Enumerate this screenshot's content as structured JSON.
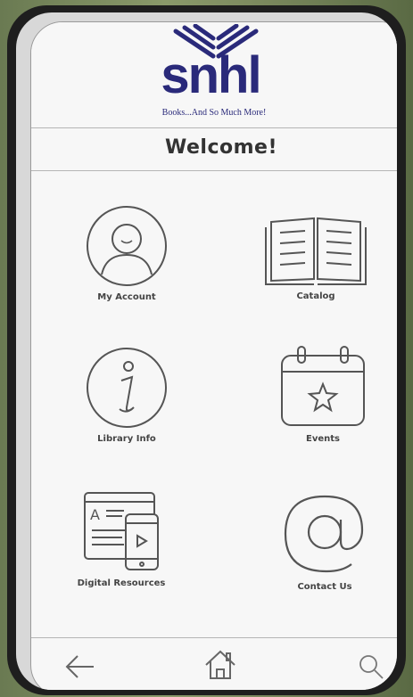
{
  "header": {
    "logo_text": "snhl",
    "tagline": "Books...And So Much More!",
    "welcome": "Welcome!"
  },
  "tiles": [
    {
      "label": "My Account",
      "icon": "account-icon"
    },
    {
      "label": "Catalog",
      "icon": "book-icon"
    },
    {
      "label": "Library Info",
      "icon": "info-icon"
    },
    {
      "label": "Events",
      "icon": "calendar-icon"
    },
    {
      "label": "Digital Resources",
      "icon": "devices-icon"
    },
    {
      "label": "Contact Us",
      "icon": "at-sign-icon"
    }
  ],
  "nav": {
    "back": "back-arrow-icon",
    "home": "home-icon",
    "search": "search-icon"
  },
  "colors": {
    "brand": "#2a2a7a",
    "text": "#333333",
    "icon_stroke": "#555555"
  }
}
